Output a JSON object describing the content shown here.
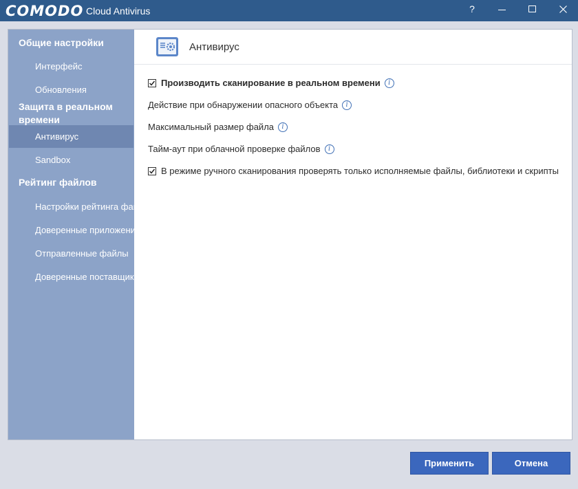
{
  "window": {
    "brand": "COMODO",
    "product": "Cloud Antivirus",
    "help_label": "?"
  },
  "sidebar": {
    "sections": [
      {
        "title": "Общие настройки"
      },
      {
        "title": "Защита в реальном времени"
      },
      {
        "title": "Рейтинг файлов"
      }
    ],
    "items": [
      {
        "label": "Интерфейс"
      },
      {
        "label": "Обновления"
      },
      {
        "label": "Антивирус",
        "active": true
      },
      {
        "label": "Sandbox"
      },
      {
        "label": "Настройки рейтинга файлов"
      },
      {
        "label": "Доверенные приложения"
      },
      {
        "label": "Отправленные файлы"
      },
      {
        "label": "Доверенные поставщики"
      }
    ]
  },
  "content": {
    "title": "Антивирус",
    "icon": "antivirus-settings-icon",
    "options": [
      {
        "label": "Производить сканирование в реальном времени",
        "checked": true,
        "bold": true,
        "info": true
      },
      {
        "label": "Действие при обнаружении опасного объекта",
        "info": true
      },
      {
        "label": "Максимальный размер файла",
        "info": true
      },
      {
        "label": "Тайм-аут при облачной проверке файлов",
        "info": true
      },
      {
        "label": "В режиме ручного сканирования проверять только исполняемые файлы, библиотеки и скрипты",
        "checked": true
      }
    ],
    "info_glyph": "i"
  },
  "footer": {
    "apply_label": "Применить",
    "cancel_label": "Отмена"
  },
  "colors": {
    "titlebar": "#2f5b8c",
    "sidebar": "#8ca3c8",
    "sidebar_active": "#6f87b1",
    "button": "#3b67bd",
    "info": "#3f6fb5"
  }
}
